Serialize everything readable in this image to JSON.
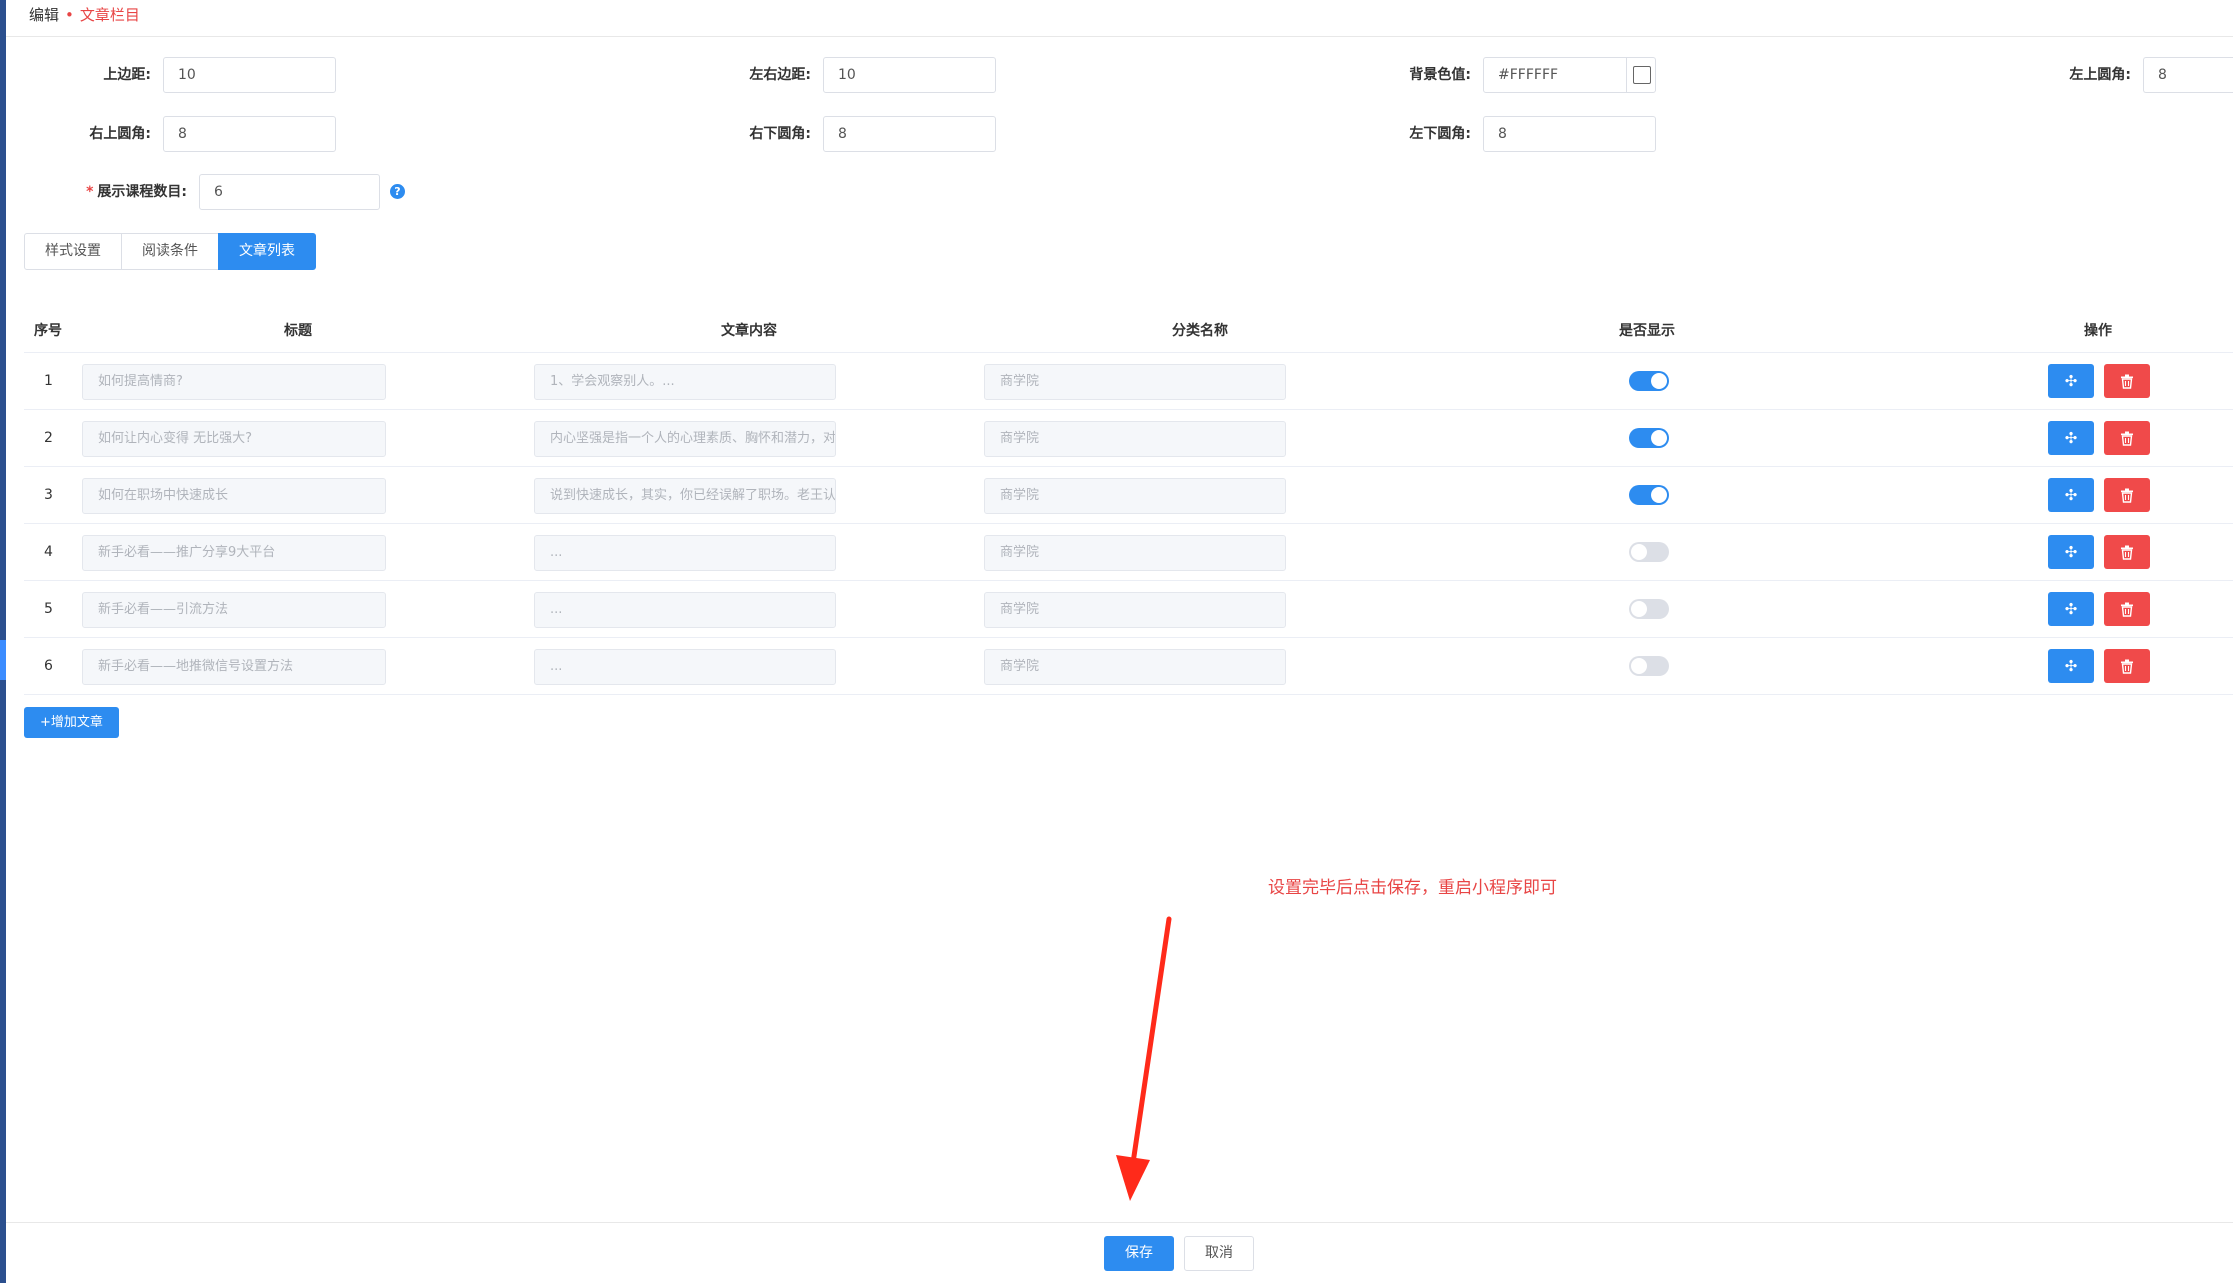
{
  "header": {
    "title": "编辑",
    "subtitle": "文章栏目"
  },
  "form": {
    "top_margin": {
      "label": "上边距:",
      "value": "10"
    },
    "side_margin": {
      "label": "左右边距:",
      "value": "10"
    },
    "bg_color": {
      "label": "背景色值:",
      "value": "#FFFFFF",
      "swatch_color": "#FFFFFF"
    },
    "radius_top_left": {
      "label": "左上圆角:",
      "value": "8"
    },
    "radius_top_right": {
      "label": "右上圆角:",
      "value": "8"
    },
    "radius_bottom_right": {
      "label": "右下圆角:",
      "value": "8"
    },
    "radius_bottom_left": {
      "label": "左下圆角:",
      "value": "8"
    },
    "course_count": {
      "required_mark": "*",
      "label": "展示课程数目:",
      "value": "6",
      "help_icon": "?"
    }
  },
  "tabs": [
    {
      "label": "样式设置",
      "active": false
    },
    {
      "label": "阅读条件",
      "active": false
    },
    {
      "label": "文章列表",
      "active": true
    }
  ],
  "table": {
    "headers": {
      "index": "序号",
      "title": "标题",
      "content": "文章内容",
      "category": "分类名称",
      "visible": "是否显示",
      "actions": "操作"
    },
    "rows": [
      {
        "index": "1",
        "title": "如何提高情商?",
        "content": "1、学会观察别人。...",
        "category": "商学院",
        "visible": true
      },
      {
        "index": "2",
        "title": "如何让内心变得 无比强大?",
        "content": "内心坚强是指一个人的心理素质、胸怀和潜力，对未来充满希望和",
        "category": "商学院",
        "visible": true
      },
      {
        "index": "3",
        "title": "如何在职场中快速成长",
        "content": "说到快速成长，其实，你已经误解了职场。老王认为，职场根本就",
        "category": "商学院",
        "visible": true
      },
      {
        "index": "4",
        "title": "新手必看——推广分享9大平台",
        "content": "...",
        "category": "商学院",
        "visible": false
      },
      {
        "index": "5",
        "title": "新手必看——引流方法",
        "content": "...",
        "category": "商学院",
        "visible": false
      },
      {
        "index": "6",
        "title": "新手必看——地推微信号设置方法",
        "content": "...",
        "category": "商学院",
        "visible": false
      }
    ],
    "move_icon": "✣",
    "delete_icon": "trash-icon"
  },
  "add_button": "+增加文章",
  "annotation": {
    "note": "设置完毕后点击保存，重启小程序即可",
    "color": "#e84545"
  },
  "footer": {
    "save": "保存",
    "cancel": "取消"
  },
  "colors": {
    "primary": "#2d8cf0",
    "danger": "#f04a4a",
    "accent_red": "#e84545"
  }
}
